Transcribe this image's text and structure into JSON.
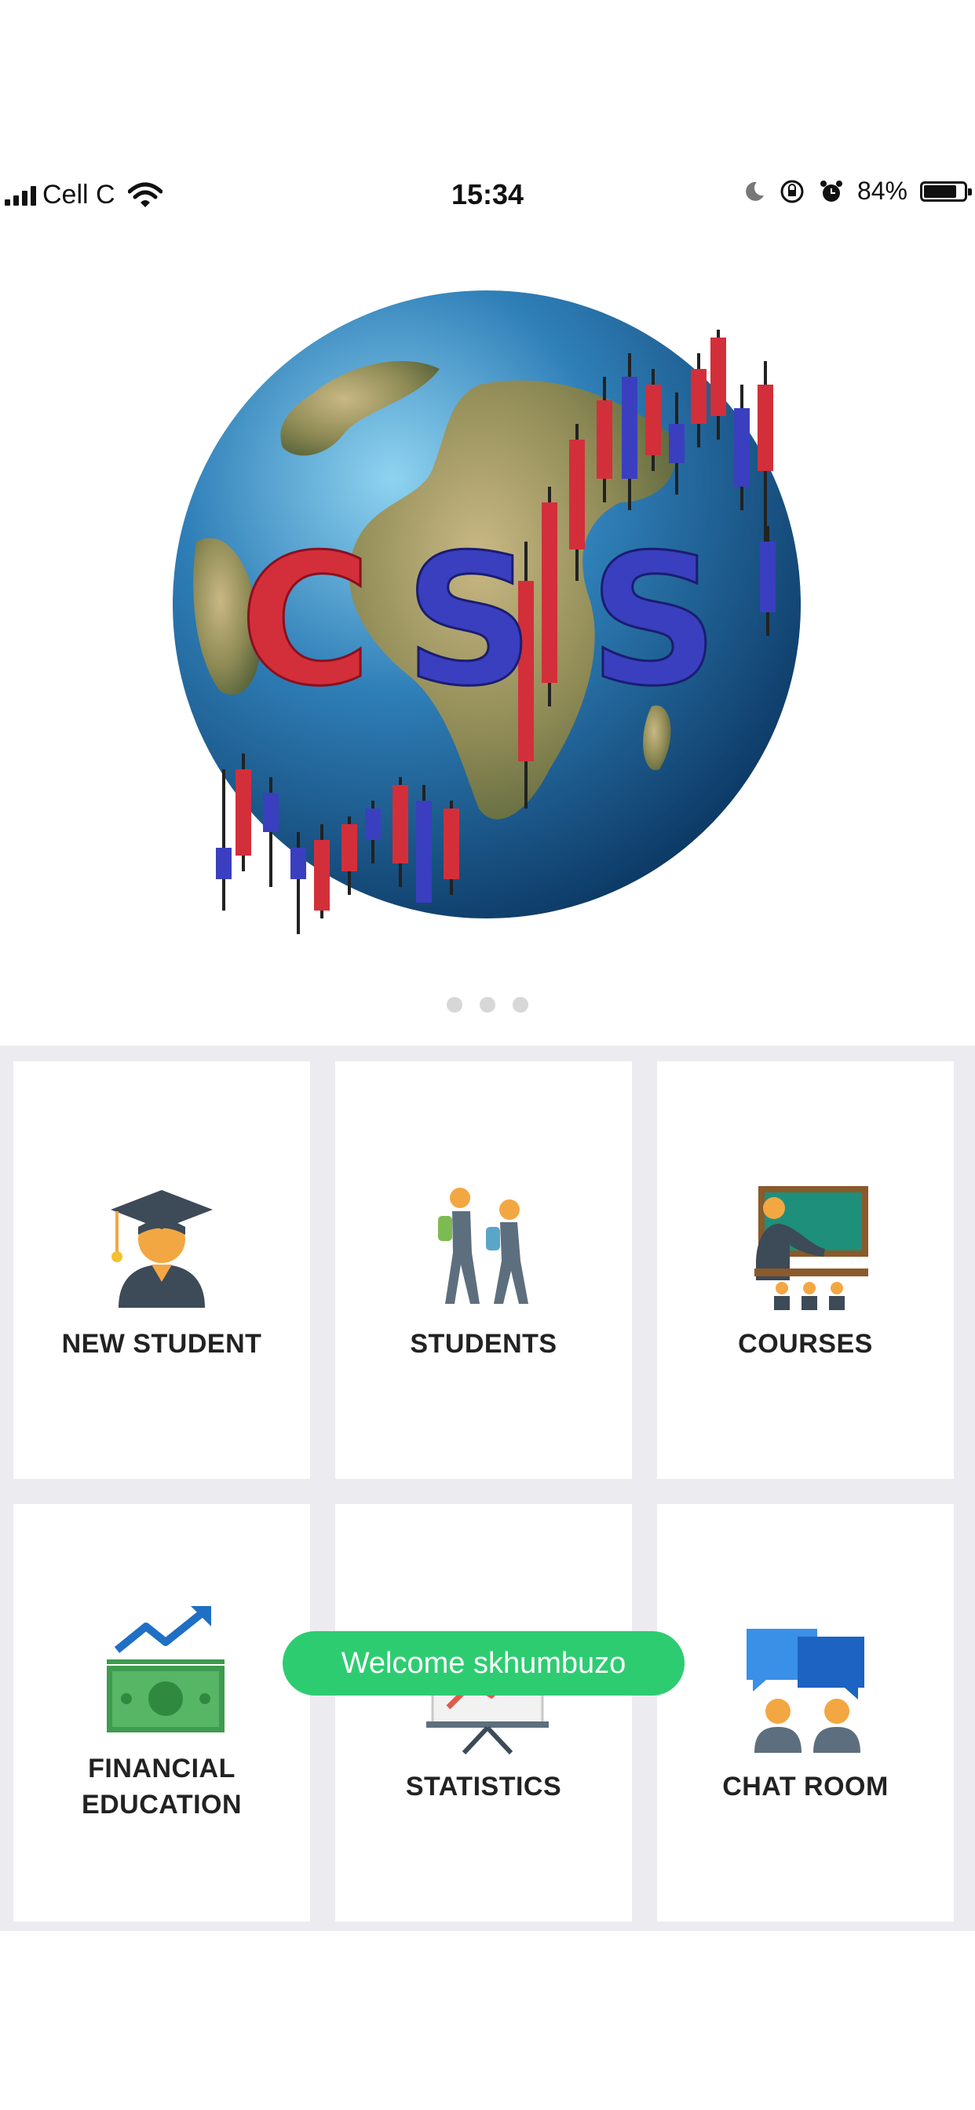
{
  "status_bar": {
    "carrier": "Cell C",
    "time": "15:34",
    "battery": "84%",
    "battery_level": 0.84
  },
  "banner": {
    "logo_letters": [
      "C",
      "S",
      "S"
    ],
    "page_count": 3
  },
  "menu": [
    {
      "label": "NEW STUDENT",
      "icon": "graduate-icon"
    },
    {
      "label": "STUDENTS",
      "icon": "students-walking-icon"
    },
    {
      "label": "COURSES",
      "icon": "teacher-classroom-icon"
    },
    {
      "label_line1": "FINANCIAL",
      "label_line2": "EDUCATION",
      "icon": "financial-growth-icon"
    },
    {
      "label": "STATISTICS",
      "icon": "presentation-chart-icon"
    },
    {
      "label": "CHAT ROOM",
      "icon": "chat-room-icon"
    }
  ],
  "toast": {
    "message": "Welcome skhumbuzo"
  },
  "colors": {
    "toast_bg": "#2ecc71",
    "grid_bg": "#ebebf0",
    "logo_red": "#d32f3a",
    "logo_blue": "#3a3fbf"
  }
}
